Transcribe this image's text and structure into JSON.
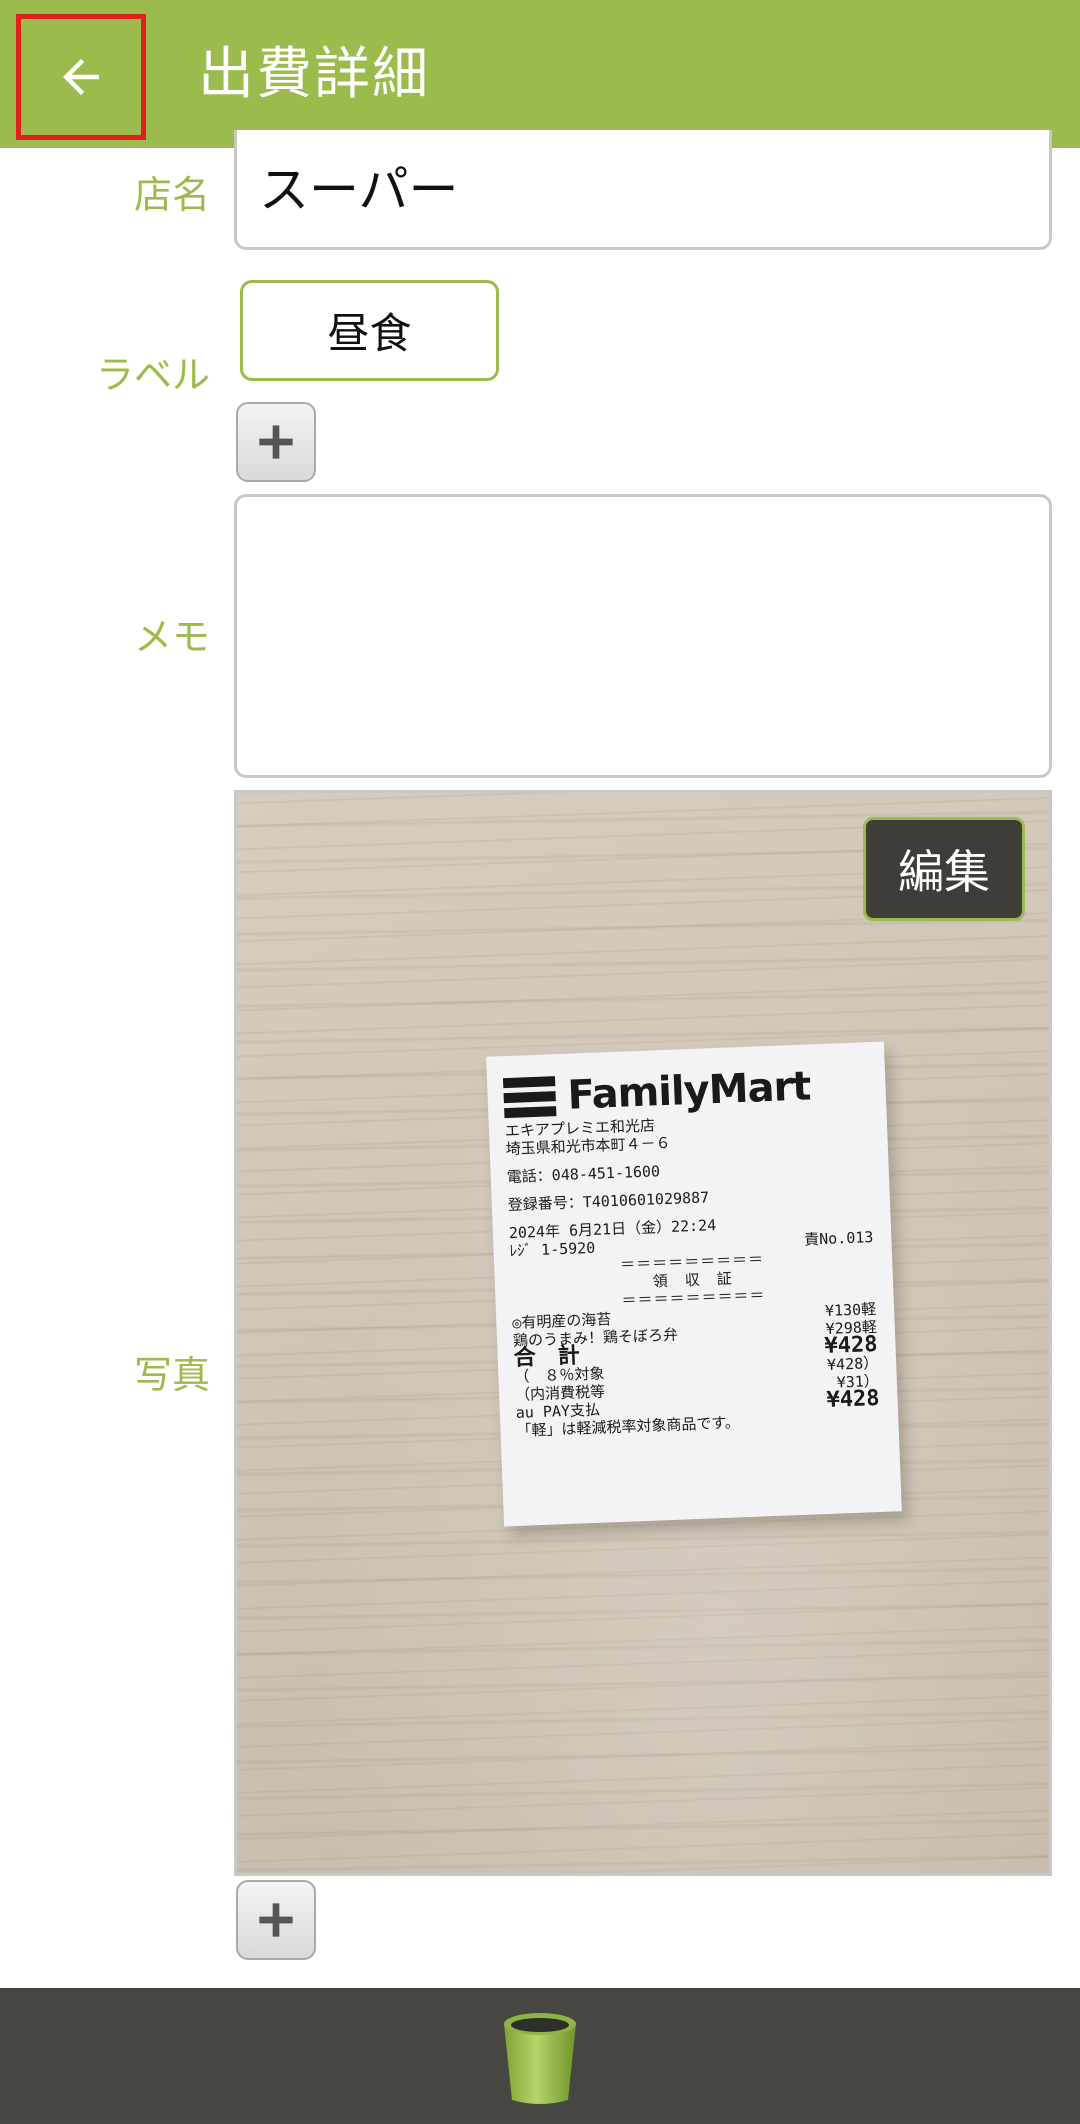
{
  "header": {
    "title": "出費詳細",
    "back_icon": "arrow-left-icon"
  },
  "form": {
    "store": {
      "label": "店名",
      "value": "スーパー"
    },
    "labels": {
      "label": "ラベル",
      "tags": [
        "昼食"
      ],
      "add_icon": "plus-icon"
    },
    "memo": {
      "label": "メモ",
      "value": ""
    },
    "photo": {
      "label": "写真",
      "edit_label": "編集",
      "add_icon": "plus-icon"
    }
  },
  "receipt": {
    "brand": "FamilyMart",
    "lines": [
      "エキアプレミエ和光店",
      "埼玉県和光市本町４－６",
      "電話：048-451-1600",
      "登録番号：T4010601029887",
      "2024年 6月21日（金）22:24",
      "ﾚｼﾞ 1-5920",
      "責No.013",
      "＝＝＝＝＝＝＝＝＝",
      "領　収　証",
      "＝＝＝＝＝＝＝＝＝",
      "◎有明産の海苔",
      "¥130軽",
      "鶏のうまみ！鶏そぼろ弁",
      "¥298軽",
      "合　計",
      "¥428",
      "（　８％対象",
      "¥428）",
      "（内消費税等",
      "¥31）",
      "au PAY支払",
      "¥428",
      "「軽」は軽減税率対象商品です。"
    ]
  },
  "footer": {
    "delete_icon": "trash-icon"
  },
  "colors": {
    "accent": "#9bbb4d",
    "bottom_bar": "#464642",
    "highlight": "#e0201c"
  }
}
